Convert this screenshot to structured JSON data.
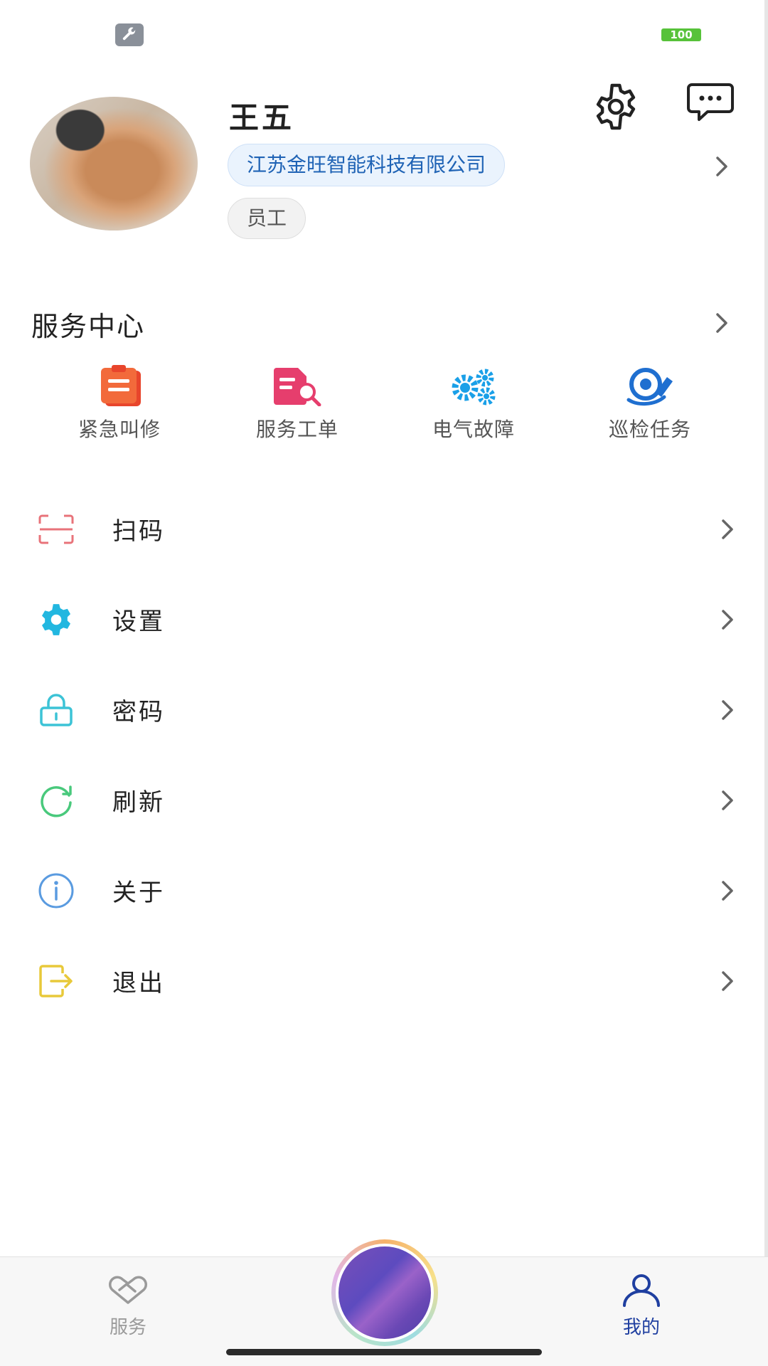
{
  "status_bar": {
    "battery": "100"
  },
  "profile": {
    "name": "王五",
    "company": "江苏金旺智能科技有限公司",
    "role": "员工"
  },
  "service_center": {
    "title": "服务中心",
    "items": [
      {
        "label": "紧急叫修",
        "icon": "clipboard-icon",
        "color": "#e8452c"
      },
      {
        "label": "服务工单",
        "icon": "document-search-icon",
        "color": "#e63e6d"
      },
      {
        "label": "电气故障",
        "icon": "gears-icon",
        "color": "#1aa0e8"
      },
      {
        "label": "巡检任务",
        "icon": "inspection-icon",
        "color": "#1f6fd0"
      }
    ]
  },
  "menu": [
    {
      "label": "扫码",
      "icon": "scan-icon",
      "color": "#e8737a"
    },
    {
      "label": "设置",
      "icon": "gear-icon",
      "color": "#22b7e0"
    },
    {
      "label": "密码",
      "icon": "lock-icon",
      "color": "#3cc3d6"
    },
    {
      "label": "刷新",
      "icon": "refresh-icon",
      "color": "#49c97c"
    },
    {
      "label": "关于",
      "icon": "info-icon",
      "color": "#5a9be0"
    },
    {
      "label": "退出",
      "icon": "logout-icon",
      "color": "#e8c93a"
    }
  ],
  "bottom_nav": {
    "tabs": [
      {
        "label": "服务",
        "icon": "handshake-icon",
        "active": false
      },
      {
        "label": "我的",
        "icon": "person-icon",
        "active": true
      }
    ]
  },
  "colors": {
    "accent": "#1f3fa0",
    "company_badge_text": "#1f63b5"
  }
}
